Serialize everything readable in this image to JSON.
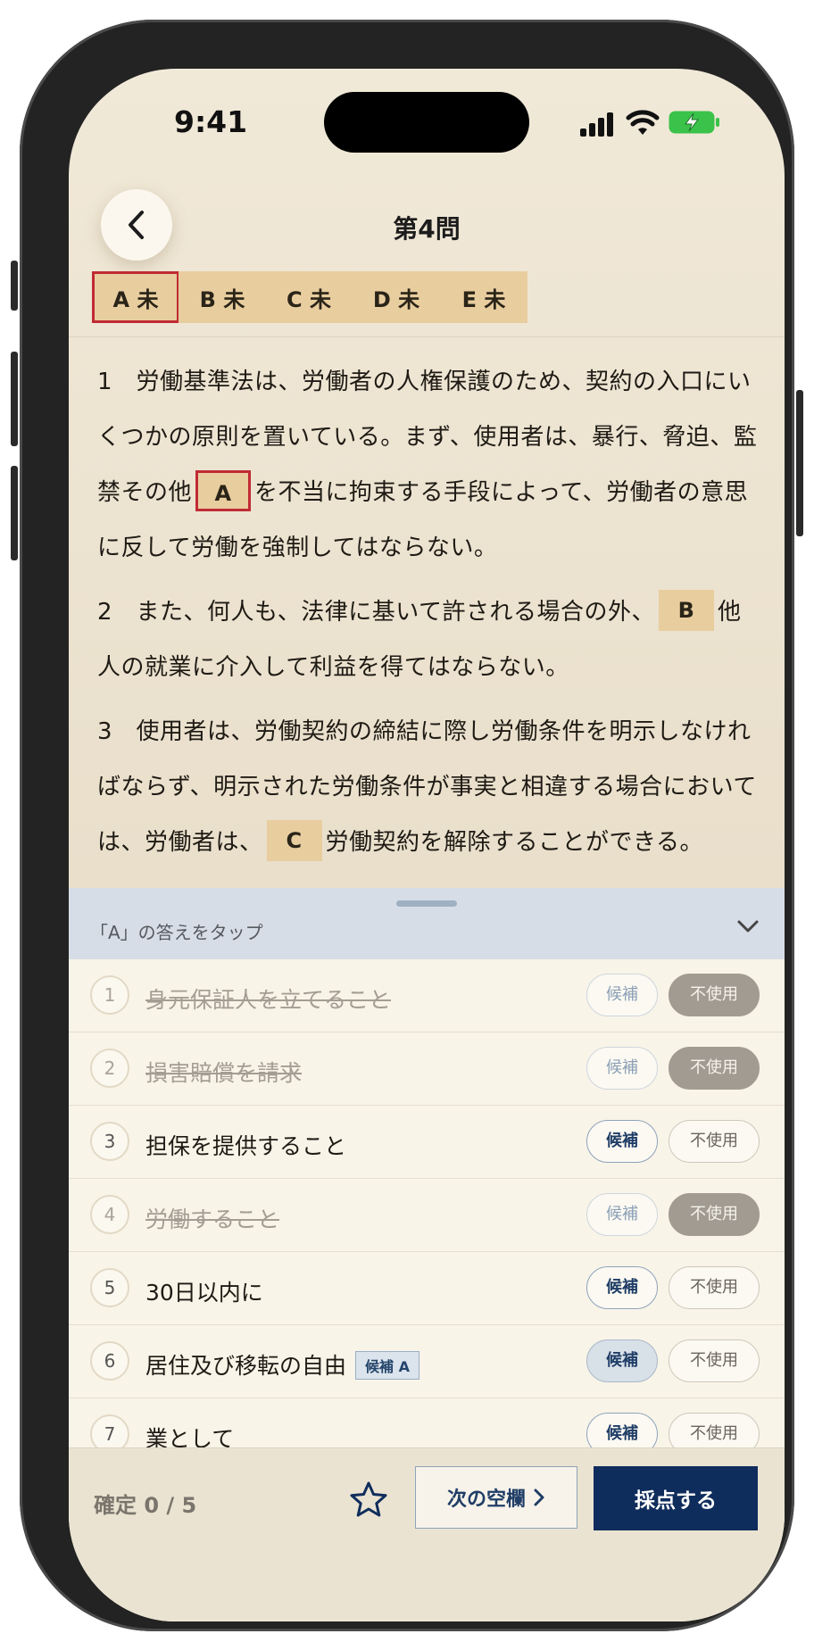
{
  "status": {
    "time": "9:41"
  },
  "header": {
    "title": "第4問"
  },
  "tabs": [
    {
      "label": "A 未",
      "active": true
    },
    {
      "label": "B 未",
      "active": false
    },
    {
      "label": "C 未",
      "active": false
    },
    {
      "label": "D 未",
      "active": false
    },
    {
      "label": "E 未",
      "active": false
    }
  ],
  "question": {
    "p1_a": "1　労働基準法は、労働者の人権保護のため、契約の入口にいくつかの原則を置いている。まず、使用者は、暴行、脅迫、監禁その他",
    "p1_blank": "A",
    "p1_b": "を不当に拘束する手段によって、労働者の意思に反して労働を強制してはならない。",
    "p2_a": "2　また、何人も、法律に基いて許される場合の外、",
    "p2_blank": "B",
    "p2_b": "他人の就業に介入して利益を得てはならない。",
    "p3_a": "3　使用者は、労働契約の締結に際し労働条件を明示しなければならず、明示された労働条件が事実と相違する場合においては、労働者は、",
    "p3_blank": "C",
    "p3_b": "労働契約を解除することができる。"
  },
  "sheet": {
    "prompt": "「A」の答えをタップ",
    "candidate_label": "候補",
    "unused_label": "不使用",
    "options": [
      {
        "num": "1",
        "text": "身元保証人を立てること",
        "unused": true
      },
      {
        "num": "2",
        "text": "損害賠償を請求",
        "unused": true
      },
      {
        "num": "3",
        "text": "担保を提供すること",
        "unused": false
      },
      {
        "num": "4",
        "text": "労働すること",
        "unused": true
      },
      {
        "num": "5",
        "text": "30日以内に",
        "unused": false
      },
      {
        "num": "6",
        "text": "居住及び移転の自由",
        "unused": false,
        "tag": "候補 A",
        "candidate_on": true
      },
      {
        "num": "7",
        "text": "業として",
        "unused": false
      }
    ]
  },
  "footer": {
    "confirm": "確定 0 / 5",
    "next_label": "次の空欄",
    "score_label": "採点する"
  },
  "colors": {
    "accent": "#0f2d5c",
    "blank": "#e8cd9f",
    "active_border": "#c02b34",
    "battery": "#3bc24a"
  }
}
